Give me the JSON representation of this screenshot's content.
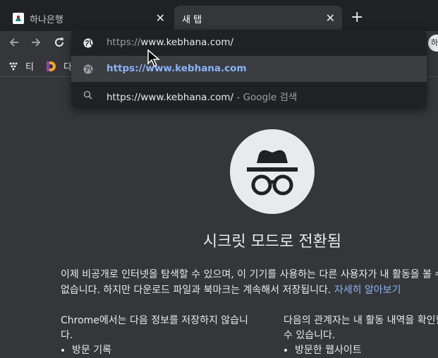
{
  "tabs": [
    {
      "title": "하나은행",
      "close": "✕"
    },
    {
      "title": "새 탭",
      "close": "✕"
    }
  ],
  "new_tab": "+",
  "profile_initial": "하",
  "bookmarks": [
    {
      "label": "티"
    },
    {
      "label": "다"
    }
  ],
  "omnibox": {
    "input_prefix": "https://",
    "input_domain": "www.kebhana.com/",
    "suggestion_url": "https://www.kebhana.com",
    "search_query": "https://www.kebhana.com/",
    "search_suffix": " - Google 검색"
  },
  "incognito": {
    "title": "시크릿 모드로 전환됨",
    "paragraph": "이제 비공개로 인터넷을 탐색할 수 있으며, 이 기기를 사용하는 다른 사용자가 내 활동을 볼 수 없습니다. 하지만 다운로드 파일과 북마크는 계속해서 저장됩니다.",
    "learn_more": "자세히 알아보기",
    "not_saved_heading": "Chrome에서는 다음 정보를 저장하지 않습니다.",
    "not_saved_item": "방문 기록",
    "visible_heading": "다음의 관계자는 내 활동 내역을 확인할 수 있습니다.",
    "visible_item": "방문한 웹사이트"
  },
  "colors": {
    "accent": "#8ab4f8",
    "background": "#35363a",
    "tabstrip": "#202124"
  }
}
